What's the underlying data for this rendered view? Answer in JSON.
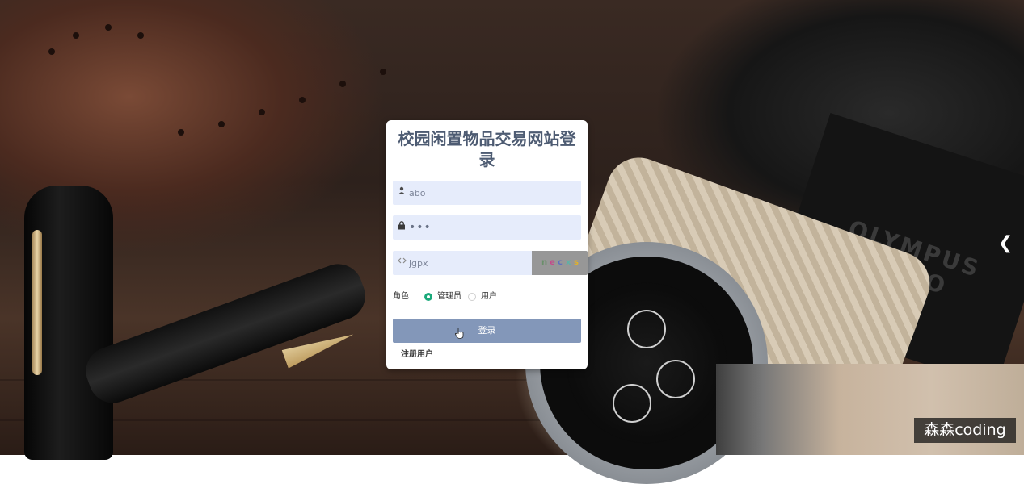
{
  "background": {
    "camera_brand_text": "OLYMPUS STUDIO",
    "watermark": "森森coding",
    "next_arrow_icon": "chevron-right-icon"
  },
  "login": {
    "title": "校园闲置物品交易网站登录",
    "username": {
      "value": "abo",
      "icon": "user-icon"
    },
    "password": {
      "value": "•••",
      "icon": "lock-icon"
    },
    "captcha": {
      "value": "jgpx",
      "icon": "code-icon",
      "image_chars": [
        "n",
        "e",
        "c",
        "x",
        "s"
      ]
    },
    "role_label": "角色",
    "roles": [
      {
        "label": "管理员",
        "selected": true
      },
      {
        "label": "用户",
        "selected": false
      }
    ],
    "login_button": "登录",
    "register_link": "注册用户"
  },
  "colors": {
    "title": "#4d5b72",
    "field_bg": "#e6ecfb",
    "button_bg": "#8397b9",
    "radio_checked": "#1aa97a"
  }
}
